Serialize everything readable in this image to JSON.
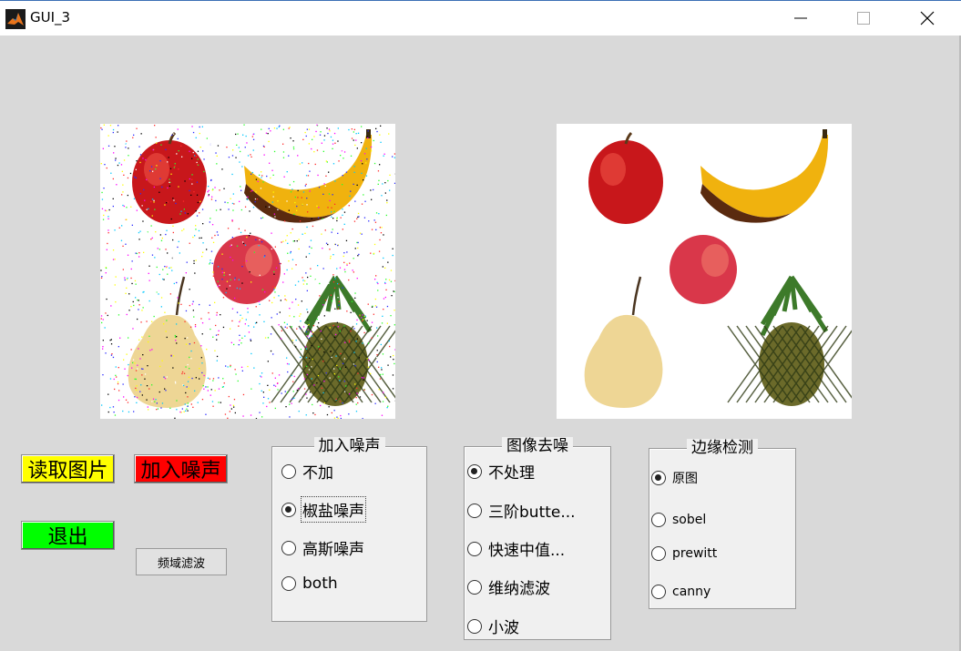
{
  "window": {
    "title": "GUI_3",
    "controls": [
      "minimize",
      "maximize",
      "close"
    ]
  },
  "images": {
    "left": {
      "content": [
        "apple-icon",
        "banana-icon",
        "peach-icon",
        "pear-icon",
        "pineapple-icon"
      ],
      "noise": "salt-and-pepper"
    },
    "right": {
      "content": [
        "apple-icon",
        "banana-icon",
        "peach-icon",
        "pear-icon",
        "pineapple-icon"
      ],
      "noise": "none"
    }
  },
  "buttons": {
    "read": {
      "label": "读取图片",
      "color": "#ffff00"
    },
    "noise": {
      "label": "加入噪声",
      "color": "#ff0000"
    },
    "exit": {
      "label": "退出",
      "color": "#00ff00"
    },
    "freq": {
      "label": "频域滤波"
    }
  },
  "noise_group": {
    "title": "加入噪声",
    "options": [
      "不加",
      "椒盐噪声",
      "高斯噪声",
      "both"
    ],
    "selected": 1
  },
  "denoise_group": {
    "title": "图像去噪",
    "options": [
      "不处理",
      "三阶butte...",
      "快速中值...",
      "维纳滤波",
      "小波"
    ],
    "selected": 0
  },
  "edge_group": {
    "title": "边缘检测",
    "options": [
      "原图",
      "sobel",
      "prewitt",
      "canny"
    ],
    "selected": 0
  }
}
